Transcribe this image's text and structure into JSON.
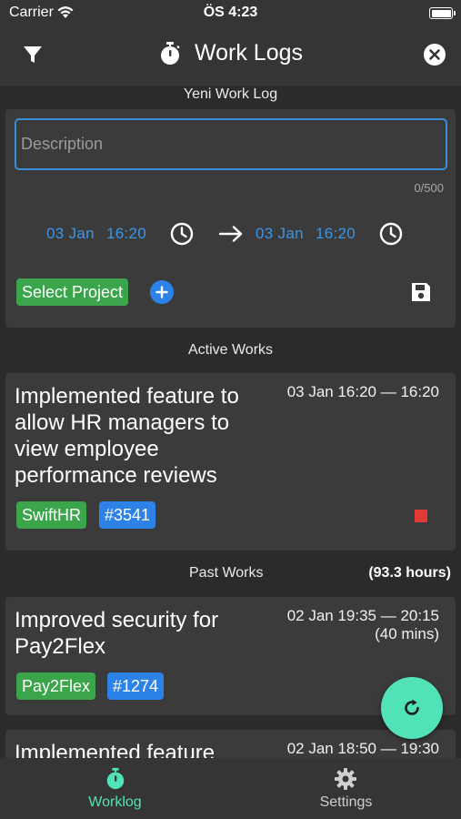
{
  "status_bar": {
    "carrier": "Carrier",
    "time": "ÖS 4:23",
    "wifi_icon": "wifi-icon",
    "battery_icon": "battery-icon"
  },
  "nav": {
    "title": "Work Logs",
    "filter_icon": "filter-icon",
    "timer_icon": "stopwatch-icon",
    "close_icon": "close-circle-icon"
  },
  "new_log": {
    "section_title": "Yeni Work Log",
    "description_placeholder": "Description",
    "description_value": "",
    "char_count": "0/500",
    "start_date": "03 Jan",
    "start_time": "16:20",
    "end_date": "03 Jan",
    "end_time": "16:20",
    "select_project_label": "Select Project"
  },
  "active": {
    "section_title": "Active Works",
    "items": [
      {
        "title": "Implemented feature to allow HR managers to view employee performance reviews",
        "time": "03 Jan 16:20  —  16:20",
        "project": "SwiftHR",
        "issue": "#3541"
      }
    ]
  },
  "past": {
    "section_title": "Past Works",
    "total": "(93.3 hours)",
    "items": [
      {
        "title": "Improved security for Pay2Flex",
        "time": "02 Jan 19:35  —  20:15",
        "duration": "(40 mins)",
        "project": "Pay2Flex",
        "issue": "#1274"
      },
      {
        "title": "Implemented feature",
        "time": "02 Jan 18:50  —  19:30"
      }
    ]
  },
  "tabs": [
    {
      "label": "Worklog",
      "icon": "stopwatch-icon",
      "active": true
    },
    {
      "label": "Settings",
      "icon": "gear-icon",
      "active": false
    }
  ],
  "colors": {
    "accent": "#3a96e6",
    "tag_green": "#3aa54a",
    "tag_blue": "#2c82e6",
    "fab": "#52e2b8",
    "active_tab": "#52e2b8",
    "inactive_tab": "#cfcfcf",
    "stop": "#e53935"
  }
}
